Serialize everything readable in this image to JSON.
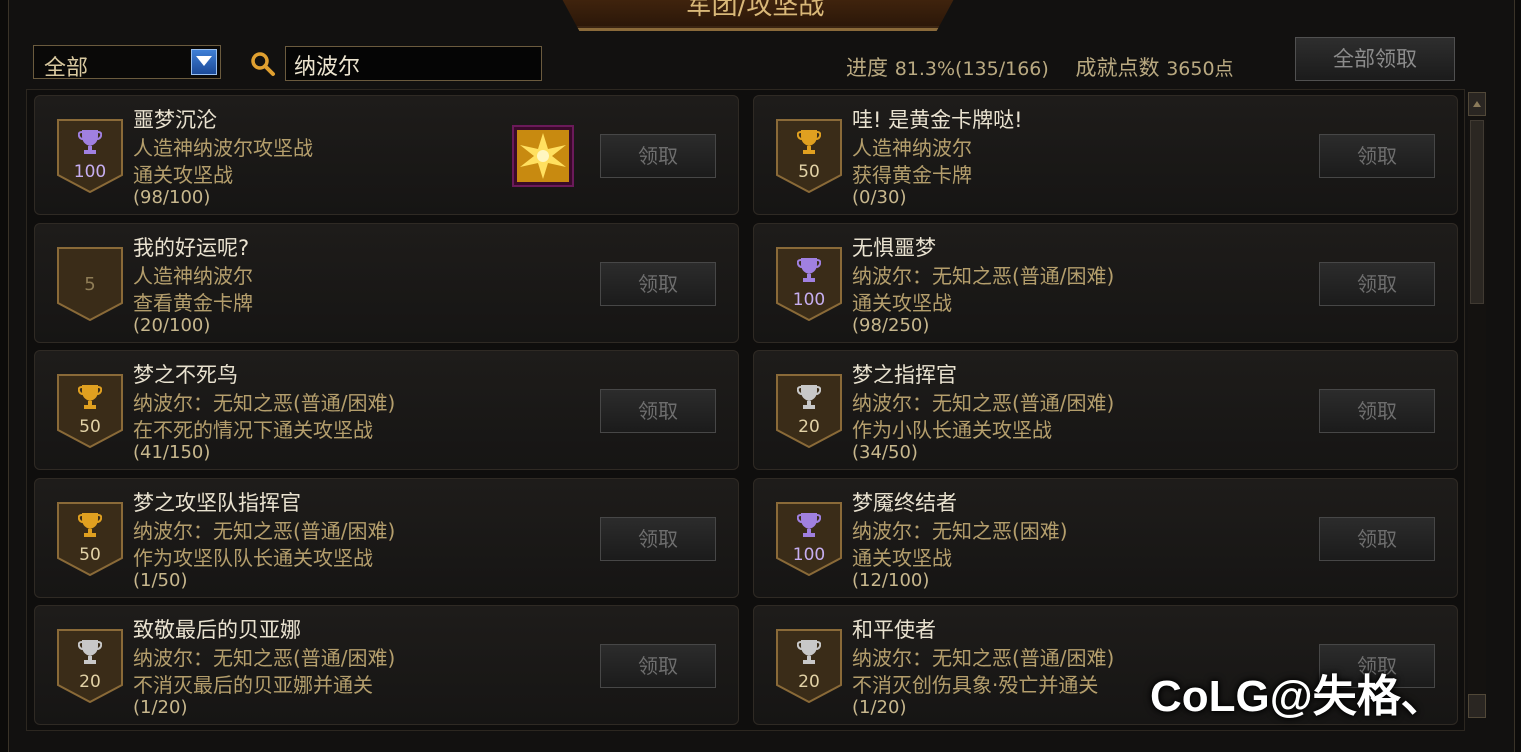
{
  "window": {
    "title": "军团/攻坚战"
  },
  "filter": {
    "dropdown_value": "全部"
  },
  "search": {
    "value": "纳波尔"
  },
  "header": {
    "progress_label": "进度",
    "progress_value": "81.3%(135/166)",
    "points_label": "成就点数",
    "points_value": "3650点",
    "claim_all_label": "全部领取"
  },
  "claim_label": "领取",
  "colors": {
    "accent_gold": "#d9b878",
    "text_gold": "#b49e6c",
    "trophy_gold": "#e0a020",
    "trophy_purple": "#a080e0",
    "trophy_silver": "#c8c8c8"
  },
  "achievements": [
    {
      "title": "噩梦沉沦",
      "line1": "人造神纳波尔攻坚战",
      "line2": "通关攻坚战",
      "progress": "(98/100)",
      "points": "100",
      "trophy": "purple",
      "has_reward": true
    },
    {
      "title": "哇! 是黄金卡牌哒!",
      "line1": "人造神纳波尔",
      "line2": "获得黄金卡牌",
      "progress": "(0/30)",
      "points": "50",
      "trophy": "gold",
      "has_reward": false
    },
    {
      "title": "我的好运呢?",
      "line1": "人造神纳波尔",
      "line2": "查看黄金卡牌",
      "progress": "(20/100)",
      "points": "5",
      "trophy": "none",
      "has_reward": false
    },
    {
      "title": "无惧噩梦",
      "line1": "纳波尔：无知之恶(普通/困难)",
      "line2": "通关攻坚战",
      "progress": "(98/250)",
      "points": "100",
      "trophy": "purple",
      "has_reward": false
    },
    {
      "title": "梦之不死鸟",
      "line1": "纳波尔：无知之恶(普通/困难)",
      "line2": "在不死的情况下通关攻坚战",
      "progress": "(41/150)",
      "points": "50",
      "trophy": "gold",
      "has_reward": false
    },
    {
      "title": "梦之指挥官",
      "line1": "纳波尔：无知之恶(普通/困难)",
      "line2": "作为小队长通关攻坚战",
      "progress": "(34/50)",
      "points": "20",
      "trophy": "silver",
      "has_reward": false
    },
    {
      "title": "梦之攻坚队指挥官",
      "line1": "纳波尔：无知之恶(普通/困难)",
      "line2": "作为攻坚队队长通关攻坚战",
      "progress": "(1/50)",
      "points": "50",
      "trophy": "gold",
      "has_reward": false
    },
    {
      "title": "梦魇终结者",
      "line1": "纳波尔：无知之恶(困难)",
      "line2": "通关攻坚战",
      "progress": "(12/100)",
      "points": "100",
      "trophy": "purple",
      "has_reward": false
    },
    {
      "title": "致敬最后的贝亚娜",
      "line1": "纳波尔：无知之恶(普通/困难)",
      "line2": "不消灭最后的贝亚娜并通关",
      "progress": "(1/20)",
      "points": "20",
      "trophy": "silver",
      "has_reward": false
    },
    {
      "title": "和平使者",
      "line1": "纳波尔：无知之恶(普通/困难)",
      "line2": "不消灭创伤具象·殁亡并通关",
      "progress": "(1/20)",
      "points": "20",
      "trophy": "silver",
      "has_reward": false
    }
  ],
  "watermark": {
    "text": "CoLG@失格、"
  }
}
